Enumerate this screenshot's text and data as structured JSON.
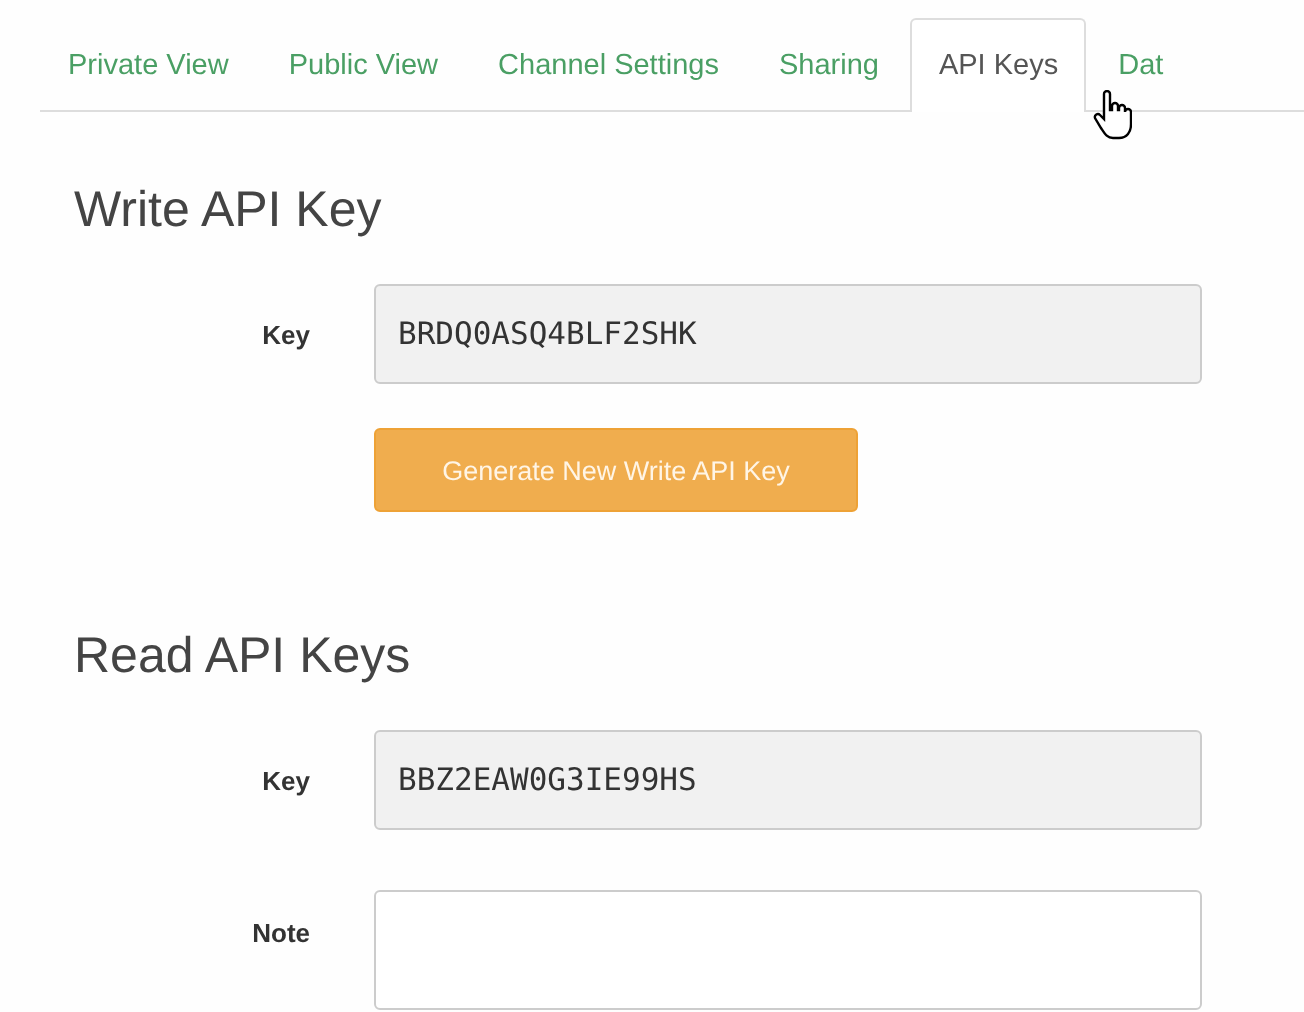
{
  "tabs": [
    {
      "label": "Private View",
      "selected": false
    },
    {
      "label": "Public View",
      "selected": false
    },
    {
      "label": "Channel Settings",
      "selected": false
    },
    {
      "label": "Sharing",
      "selected": false
    },
    {
      "label": "API Keys",
      "selected": true
    },
    {
      "label": "Dat",
      "selected": false
    }
  ],
  "write_section": {
    "title": "Write API Key",
    "key_label": "Key",
    "key_value": "BRDQ0ASQ4BLF2SHK",
    "button": "Generate New Write API Key"
  },
  "read_section": {
    "title": "Read API Keys",
    "key_label": "Key",
    "key_value": "BBZ2EAW0G3IE99HS",
    "note_label": "Note"
  }
}
